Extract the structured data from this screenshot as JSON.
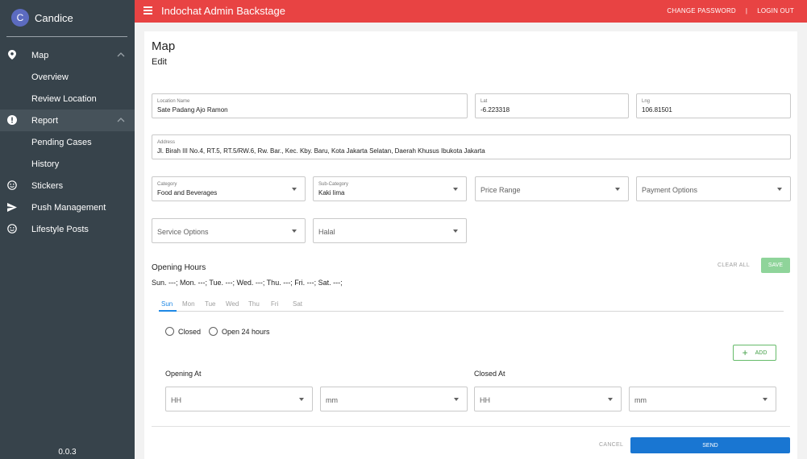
{
  "user": {
    "initial": "C",
    "name": "Candice"
  },
  "sidebar": {
    "items": [
      {
        "label": "Map",
        "icon": "map-pin-icon"
      },
      {
        "label": "Overview"
      },
      {
        "label": "Review Location"
      },
      {
        "label": "Report",
        "icon": "alert-circle-icon"
      },
      {
        "label": "Pending Cases"
      },
      {
        "label": "History"
      },
      {
        "label": "Stickers",
        "icon": "smiley-icon"
      },
      {
        "label": "Push Management",
        "icon": "send-icon"
      },
      {
        "label": "Lifestyle Posts",
        "icon": "smiley-icon"
      }
    ],
    "version": "0.0.3"
  },
  "topbar": {
    "title": "Indochat Admin Backstage",
    "change_password": "CHANGE PASSWORD",
    "separator": "|",
    "logout": "LOGIN OUT",
    "color": "#e84343"
  },
  "page": {
    "title": "Map",
    "subtitle": "Edit"
  },
  "form": {
    "location_name": {
      "label": "Location Name",
      "value": "Sate Padang Ajo Ramon"
    },
    "lat": {
      "label": "Lat",
      "value": "-6.223318"
    },
    "lng": {
      "label": "Lng",
      "value": "106.81501"
    },
    "address": {
      "label": "Address",
      "value": "Jl. Birah III No.4, RT.5, RT.5/RW.6, Rw. Bar., Kec. Kby. Baru, Kota Jakarta Selatan, Daerah Khusus Ibukota Jakarta"
    },
    "category": {
      "label": "Category",
      "value": "Food and Beverages"
    },
    "sub_category": {
      "label": "Sub-Category",
      "value": "Kaki lima"
    },
    "price_range": {
      "placeholder": "Price Range"
    },
    "payment_options": {
      "placeholder": "Payment Options"
    },
    "service_options": {
      "placeholder": "Service Options"
    },
    "halal": {
      "placeholder": "Halal"
    }
  },
  "opening_hours": {
    "title": "Opening Hours",
    "clear_all": "CLEAR ALL",
    "save": "SAVE",
    "summary": "Sun. ---; Mon. ---; Tue. ---; Wed. ---; Thu. ---; Fri. ---; Sat. ---;",
    "tabs": [
      "Sun",
      "Mon",
      "Tue",
      "Wed",
      "Thu",
      "Fri",
      "Sat"
    ],
    "active_tab": "Sun",
    "radio_closed": "Closed",
    "radio_open24": "Open 24 hours",
    "add": "ADD",
    "opening_at": "Opening At",
    "closed_at": "Closed At",
    "hh": "HH",
    "mm": "mm"
  },
  "actions": {
    "cancel": "CANCEL",
    "send": "SEND"
  },
  "colors": {
    "sidebar": "#37434b",
    "accent_blue": "#1976d2",
    "save_green": "#8fd49a"
  }
}
